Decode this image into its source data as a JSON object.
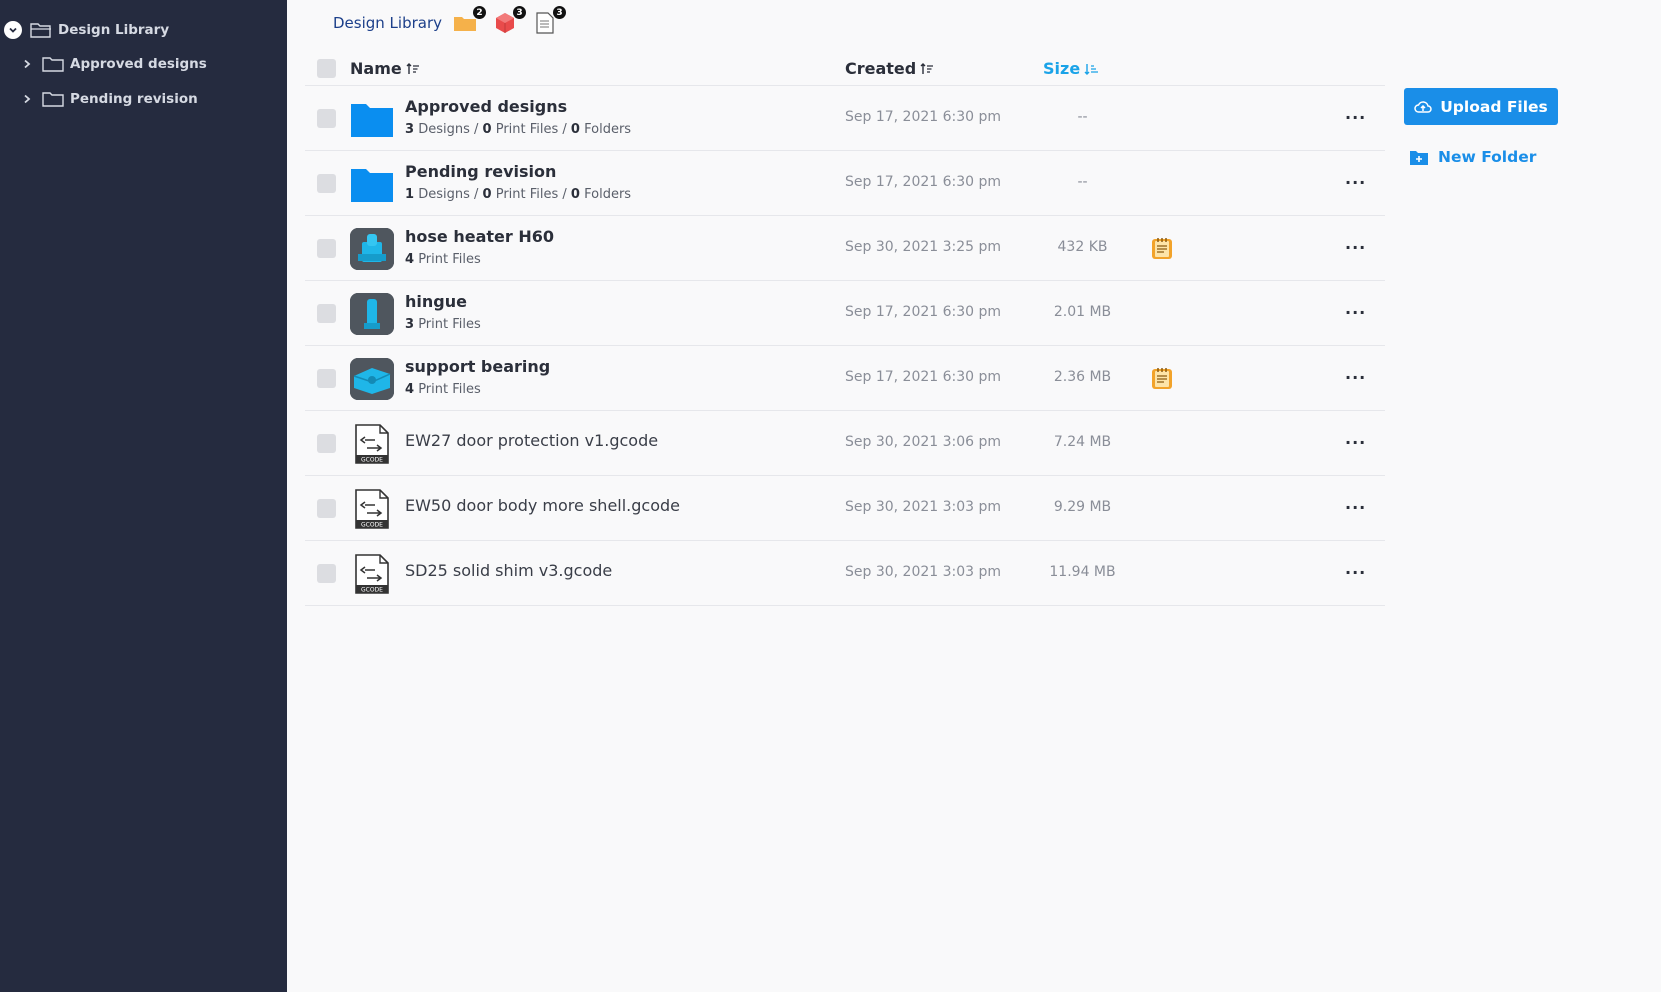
{
  "sidebar": {
    "root": {
      "label": "Design Library"
    },
    "items": [
      {
        "label": "Approved designs"
      },
      {
        "label": "Pending revision"
      }
    ]
  },
  "breadcrumb": {
    "title": "Design Library",
    "counts": {
      "folders": "2",
      "designs": "3",
      "print_files": "3"
    }
  },
  "table": {
    "headers": {
      "name": "Name",
      "created": "Created",
      "size": "Size"
    },
    "rows": [
      {
        "title": "Approved designs",
        "sub": {
          "designs": "3",
          "designs_label": "Designs",
          "print": "0",
          "print_label": "Print Files",
          "folders": "0",
          "folders_label": "Folders"
        },
        "created": "Sep 17, 2021 6:30 pm",
        "size": "--"
      },
      {
        "title": "Pending revision",
        "sub": {
          "designs": "1",
          "designs_label": "Designs",
          "print": "0",
          "print_label": "Print Files",
          "folders": "0",
          "folders_label": "Folders"
        },
        "created": "Sep 17, 2021 6:30 pm",
        "size": "--"
      },
      {
        "title": "hose heater H60",
        "sub": {
          "print": "4",
          "print_label": "Print Files"
        },
        "created": "Sep 30, 2021 3:25 pm",
        "size": "432 KB"
      },
      {
        "title": "hingue",
        "sub": {
          "print": "3",
          "print_label": "Print Files"
        },
        "created": "Sep 17, 2021 6:30 pm",
        "size": "2.01 MB"
      },
      {
        "title": "support bearing",
        "sub": {
          "print": "4",
          "print_label": "Print Files"
        },
        "created": "Sep 17, 2021 6:30 pm",
        "size": "2.36 MB"
      },
      {
        "title": "EW27 door protection v1.gcode",
        "created": "Sep 30, 2021 3:06 pm",
        "size": "7.24 MB"
      },
      {
        "title": "EW50 door body more shell.gcode",
        "created": "Sep 30, 2021 3:03 pm",
        "size": "9.29 MB"
      },
      {
        "title": "SD25 solid shim v3.gcode",
        "created": "Sep 30, 2021 3:03 pm",
        "size": "11.94 MB"
      }
    ],
    "gcode_label": "GCODE",
    "more_label": "···"
  },
  "actions": {
    "upload_label": "Upload Files",
    "new_folder_label": "New Folder"
  },
  "colors": {
    "sidebar_bg": "#252b3f",
    "accent": "#1a8ee8",
    "folder_blue": "#0a8ef0",
    "note_orange": "#f2a32a"
  }
}
